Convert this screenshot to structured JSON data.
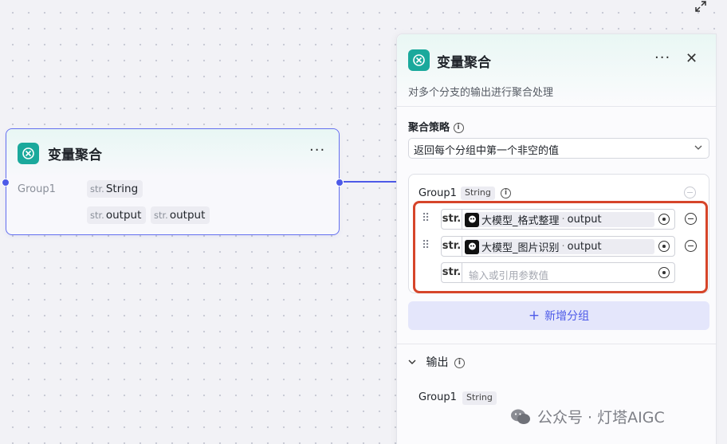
{
  "node": {
    "title": "变量聚合",
    "more": "···",
    "group_label": "Group1",
    "type_prefix": "str.",
    "type_value": "String",
    "outputs": [
      "output",
      "output"
    ]
  },
  "panel": {
    "title": "变量聚合",
    "more": "···",
    "close": "✕",
    "description": "对多个分支的输出进行聚合处理",
    "strategy": {
      "label": "聚合策略",
      "value": "返回每个分组中第一个非空的值"
    },
    "group": {
      "name": "Group1",
      "type": "String",
      "rows": [
        {
          "type": "str.",
          "ref_node": "大模型_格式整理",
          "ref_field": "output"
        },
        {
          "type": "str.",
          "ref_node": "大模型_图片识别",
          "ref_field": "output"
        },
        {
          "type": "str.",
          "placeholder": "输入或引用参数值"
        }
      ]
    },
    "add_group_label": "新增分组",
    "output": {
      "label": "输出",
      "item_name": "Group1",
      "item_type": "String"
    }
  },
  "watermark": "公众号 · 灯塔AIGC",
  "colors": {
    "accent": "#4d5ae8",
    "node_icon": "#1aa99c",
    "highlight": "#d6452a"
  }
}
